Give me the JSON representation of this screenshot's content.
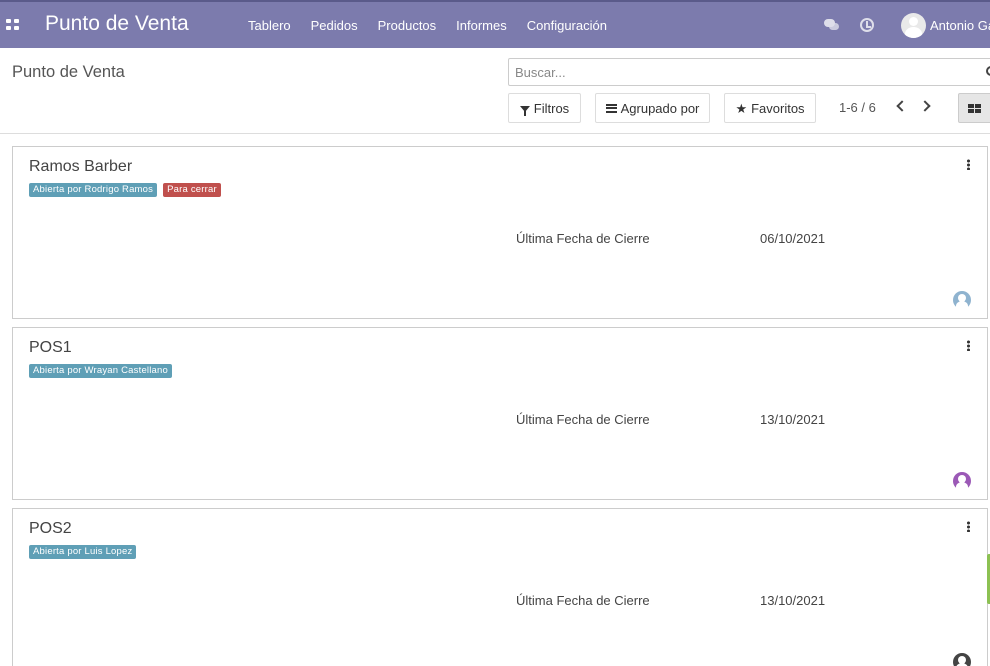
{
  "navbar": {
    "brand": "Punto de Venta",
    "menu": [
      "Tablero",
      "Pedidos",
      "Productos",
      "Informes",
      "Configuración"
    ],
    "user_name": "Antonio Ga"
  },
  "controlpanel": {
    "breadcrumb": "Punto de Venta",
    "search_placeholder": "Buscar...",
    "filters_label": "Filtros",
    "groupby_label": "Agrupado por",
    "favorites_label": "Favoritos",
    "pager": "1-6 / 6"
  },
  "cards": [
    {
      "title": "Ramos Barber",
      "badges": [
        {
          "text": "Abierta por Rodrigo Ramos",
          "color": "#5f9fb6"
        },
        {
          "text": "Para cerrar",
          "color": "#c0504d"
        }
      ],
      "field_label": "Última Fecha de Cierre",
      "field_value": "06/10/2021",
      "avatar_color": "#8fb3cf"
    },
    {
      "title": "POS1",
      "badges": [
        {
          "text": "Abierta por Wrayan Castellano",
          "color": "#5f9fb6"
        }
      ],
      "field_label": "Última Fecha de Cierre",
      "field_value": "13/10/2021",
      "avatar_color": "#9b59b6"
    },
    {
      "title": "POS2",
      "badges": [
        {
          "text": "Abierta por Luis Lopez",
          "color": "#5f9fb6"
        }
      ],
      "field_label": "Última Fecha de Cierre",
      "field_value": "13/10/2021",
      "avatar_color": "#444444"
    }
  ]
}
